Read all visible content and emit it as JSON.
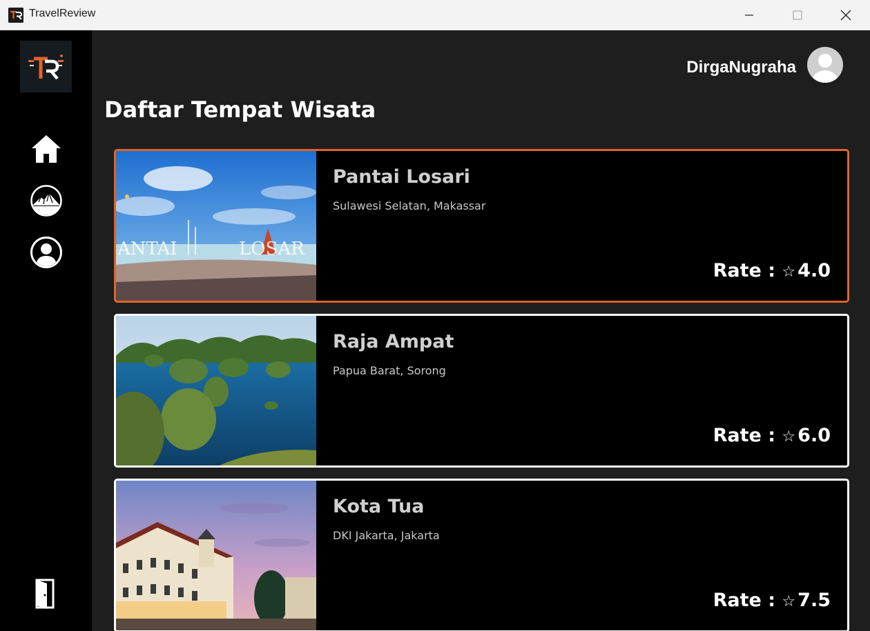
{
  "window": {
    "title": "TravelReview"
  },
  "sidebar": {
    "logo_text": "TR",
    "items": [
      {
        "name": "home",
        "icon": "home-icon"
      },
      {
        "name": "destinations",
        "icon": "mountain-icon"
      },
      {
        "name": "profile",
        "icon": "user-circle-icon"
      }
    ],
    "logout_icon": "door-exit-icon"
  },
  "header": {
    "username": "DirgaNugraha",
    "avatar_icon": "avatar-icon"
  },
  "page_title": "Daftar Tempat Wisata",
  "rate_label": "Rate :",
  "star_glyph": "☆",
  "destinations": [
    {
      "name": "Pantai Losari",
      "location": "Sulawesi Selatan, Makassar",
      "rating": "4.0",
      "selected": true
    },
    {
      "name": "Raja Ampat",
      "location": "Papua Barat, Sorong",
      "rating": "6.0",
      "selected": false
    },
    {
      "name": "Kota Tua",
      "location": "DKI Jakarta, Jakarta",
      "rating": "7.5",
      "selected": false
    }
  ],
  "colors": {
    "accent": "#e0632a",
    "background": "#1e1e1e",
    "sidebar": "#000000",
    "card": "#000000"
  }
}
